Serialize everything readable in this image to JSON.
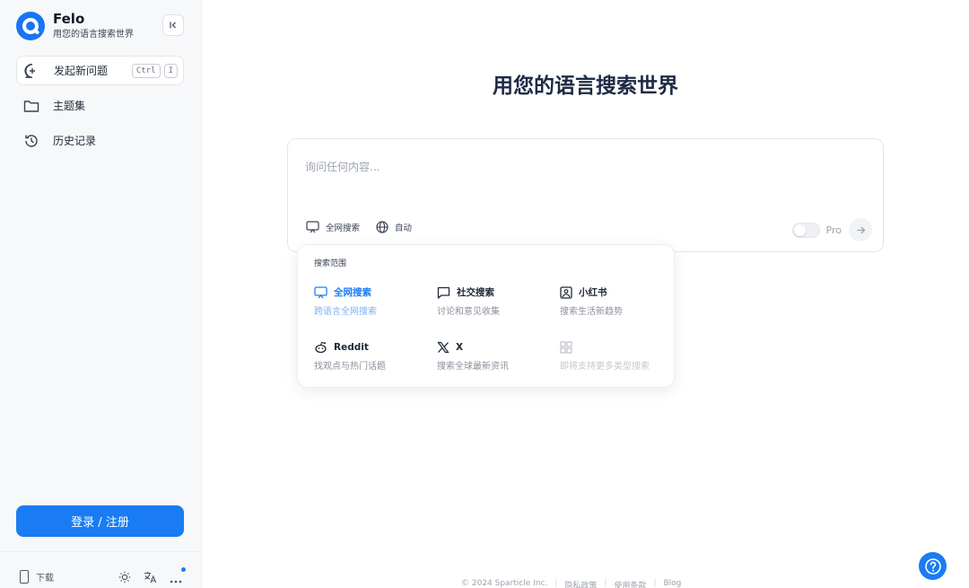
{
  "brand": {
    "name": "Felo",
    "tagline": "用您的语言搜索世界"
  },
  "sidebar": {
    "items": [
      {
        "label": "发起新问题",
        "icon": "new-chat-icon",
        "shortcut": [
          "Ctrl",
          "I"
        ]
      },
      {
        "label": "主题集",
        "icon": "folder-icon"
      },
      {
        "label": "历史记录",
        "icon": "history-icon"
      }
    ],
    "login_label": "登录 / 注册",
    "download_label": "下载"
  },
  "main": {
    "title": "用您的语言搜索世界",
    "search_placeholder": "询问任何内容...",
    "options": [
      {
        "label": "全网搜索",
        "icon": "monitor-icon"
      },
      {
        "label": "自动",
        "icon": "globe-icon"
      }
    ],
    "pro_label": "Pro",
    "pro_enabled": false
  },
  "dropdown": {
    "title": "搜索范围",
    "items": [
      {
        "title": "全网搜索",
        "subtitle": "跨语言全网搜索",
        "icon": "monitor-icon",
        "state": "selected"
      },
      {
        "title": "社交搜索",
        "subtitle": "讨论和意见收集",
        "icon": "chat-bubble-icon",
        "state": "normal"
      },
      {
        "title": "小红书",
        "subtitle": "搜索生活新趋势",
        "icon": "image-icon",
        "state": "normal"
      },
      {
        "title": "Reddit",
        "subtitle": "找观点与热门话题",
        "icon": "reddit-icon",
        "state": "normal"
      },
      {
        "title": "X",
        "subtitle": "搜索全球最新资讯",
        "icon": "x-logo-icon",
        "state": "normal"
      },
      {
        "title": "",
        "subtitle": "即将支持更多类型搜索",
        "icon": "grid-icon",
        "state": "disabled"
      }
    ]
  },
  "footer": {
    "copyright": "© 2024 Sparticle Inc.",
    "links": [
      "隐私政策",
      "使用条款",
      "Blog"
    ]
  },
  "colors": {
    "accent": "#1a7cf3",
    "sidebar_bg": "#f7f8fa"
  }
}
